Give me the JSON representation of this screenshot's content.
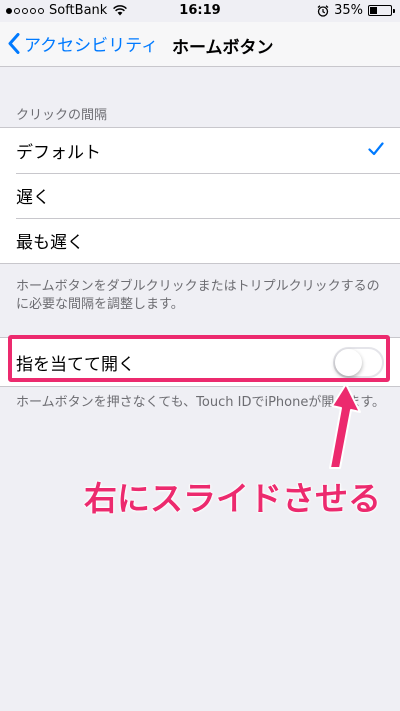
{
  "status_bar": {
    "carrier": "SoftBank",
    "time": "16:19",
    "battery": "35%",
    "signal_strength": 1
  },
  "nav": {
    "back_label": "アクセシビリティ",
    "title": "ホームボタン"
  },
  "click_interval": {
    "header": "クリックの間隔",
    "options": [
      {
        "label": "デフォルト",
        "selected": true
      },
      {
        "label": "遅く",
        "selected": false
      },
      {
        "label": "最も遅く",
        "selected": false
      }
    ],
    "footer": "ホームボタンをダブルクリックまたはトリプルクリックするのに必要な間隔を調整します。"
  },
  "rest_finger": {
    "label": "指を当てて開く",
    "enabled": false,
    "footer": "ホームボタンを押さなくても、Touch IDでiPhoneが開きます。"
  },
  "annotation": {
    "text": "右にスライドさせる",
    "color": "#ec2a6e"
  },
  "colors": {
    "accent": "#007aff",
    "background": "#efeff4"
  }
}
